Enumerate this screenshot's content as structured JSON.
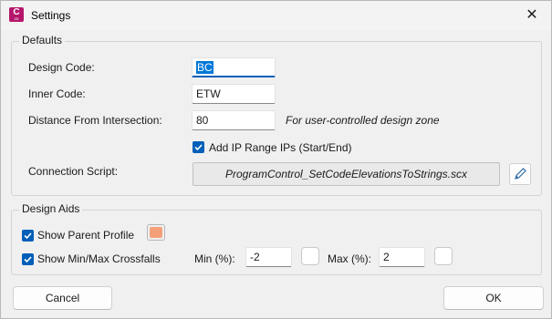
{
  "window": {
    "title": "Settings",
    "icon_letter": "C",
    "icon_sub": "2D",
    "close_glyph": "✕"
  },
  "defaults": {
    "group_title": "Defaults",
    "design_code_label": "Design Code:",
    "design_code_value": "BC",
    "inner_code_label": "Inner Code:",
    "inner_code_value": "ETW",
    "distance_label": "Distance From Intersection:",
    "distance_value": "80",
    "distance_hint": "For user-controlled design zone",
    "add_ip_label": "Add IP Range IPs (Start/End)",
    "add_ip_checked": true,
    "connection_label": "Connection Script:",
    "connection_value": "ProgramControl_SetCodeElevationsToStrings.scx"
  },
  "design_aids": {
    "group_title": "Design Aids",
    "show_parent_label": "Show Parent Profile",
    "show_parent_checked": true,
    "parent_color": "#f4a07a",
    "show_minmax_label": "Show Min/Max Crossfalls",
    "show_minmax_checked": true,
    "min_label": "Min (%):",
    "min_value": "-2",
    "max_label": "Max (%):",
    "max_value": "2"
  },
  "buttons": {
    "cancel": "Cancel",
    "ok": "OK"
  },
  "colors": {
    "accent": "#005fb8",
    "app_icon": "#b5166b"
  },
  "icons": {
    "check": "check-icon",
    "edit": "pencil-icon",
    "close": "close-icon"
  }
}
